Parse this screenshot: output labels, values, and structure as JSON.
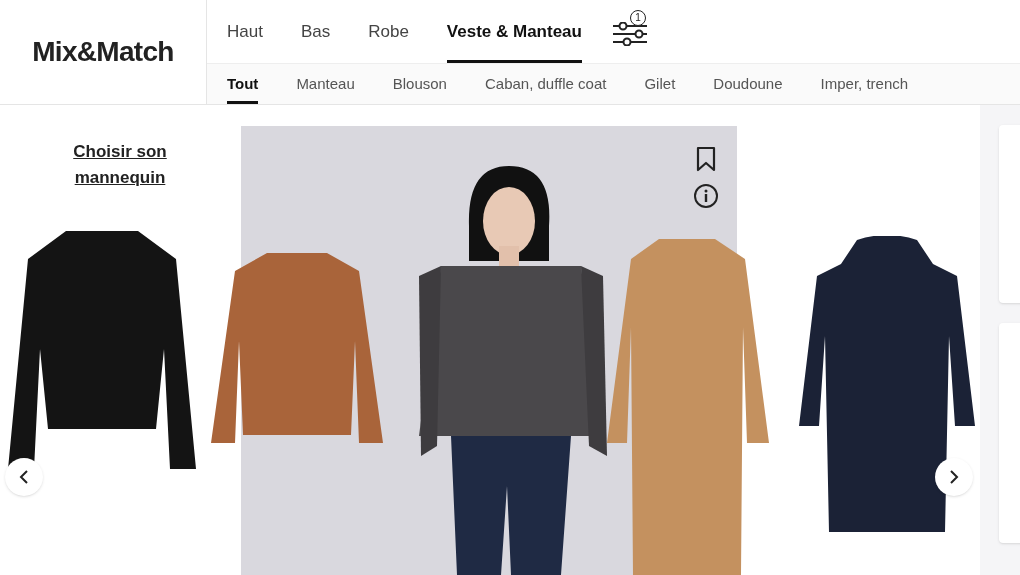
{
  "brand": {
    "logo": "Mix&Match"
  },
  "category_tabs": [
    {
      "label": "Haut",
      "selected": false
    },
    {
      "label": "Bas",
      "selected": false
    },
    {
      "label": "Robe",
      "selected": false
    },
    {
      "label": "Veste & Manteau",
      "selected": true
    }
  ],
  "filter": {
    "badge": "1"
  },
  "subcategory_tabs": [
    {
      "label": "Tout",
      "selected": true
    },
    {
      "label": "Manteau",
      "selected": false
    },
    {
      "label": "Blouson",
      "selected": false
    },
    {
      "label": "Caban, duffle coat",
      "selected": false
    },
    {
      "label": "Gilet",
      "selected": false
    },
    {
      "label": "Doudoune",
      "selected": false
    },
    {
      "label": "Imper, trench",
      "selected": false
    }
  ],
  "model_link": "Choisir son mannequin"
}
